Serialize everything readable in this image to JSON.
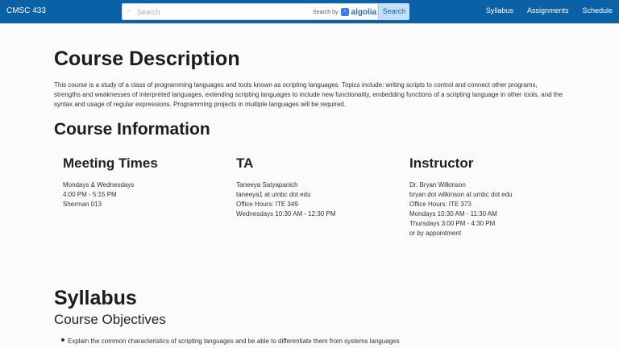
{
  "navbar": {
    "brand": "CMSC 433",
    "search": {
      "placeholder": "Search",
      "search_by": "Search by",
      "provider": "algolia",
      "button": "Search"
    },
    "links": [
      "Syllabus",
      "Assignments",
      "Schedule"
    ]
  },
  "course_description": {
    "title": "Course Description",
    "text": "This course is a study of a class of programming languages and tools known as scripting languages. Topics include: writing scripts to control and connect other programs, strengths and weaknesses of interpreted languages, extending scripting languages to include new functionality, embedding functions of a scripting language in other tools, and the syntax and usage of regular expressions. Programming projects in multiple languages will be required."
  },
  "course_information": {
    "title": "Course Information",
    "columns": [
      {
        "heading": "Meeting Times",
        "lines": [
          "Mondays & Wednesdays",
          "4:00 PM - 5:15 PM",
          "Sherman 013"
        ]
      },
      {
        "heading": "TA",
        "lines": [
          "Taneeya Satyapanich",
          "taneeya1 at umbc dot edu",
          "Office Hours: ITE 349",
          "Wednesdays 10:30 AM - 12:30 PM"
        ]
      },
      {
        "heading": "Instructor",
        "lines": [
          "Dr. Bryan Wilkinson",
          "bryan dot wilkinson at umbc dot edu",
          "Office Hours: ITE 373",
          "Mondays 10:30 AM - 11:30 AM",
          "Thursdays 3:00 PM - 4:30 PM",
          "or by appointment"
        ]
      }
    ]
  },
  "syllabus": {
    "title": "Syllabus",
    "subtitle": "Course Objectives",
    "objectives": [
      "Explain the common characteristics of scripting languages and be able to differentiate them from systems languages"
    ]
  },
  "colors": {
    "navbar": "#0a61a6",
    "search_button": "#bfe0ff",
    "background": "#fbfbfd"
  },
  "icons": {
    "search": "search-icon",
    "algolia": "algolia-logo-icon"
  }
}
